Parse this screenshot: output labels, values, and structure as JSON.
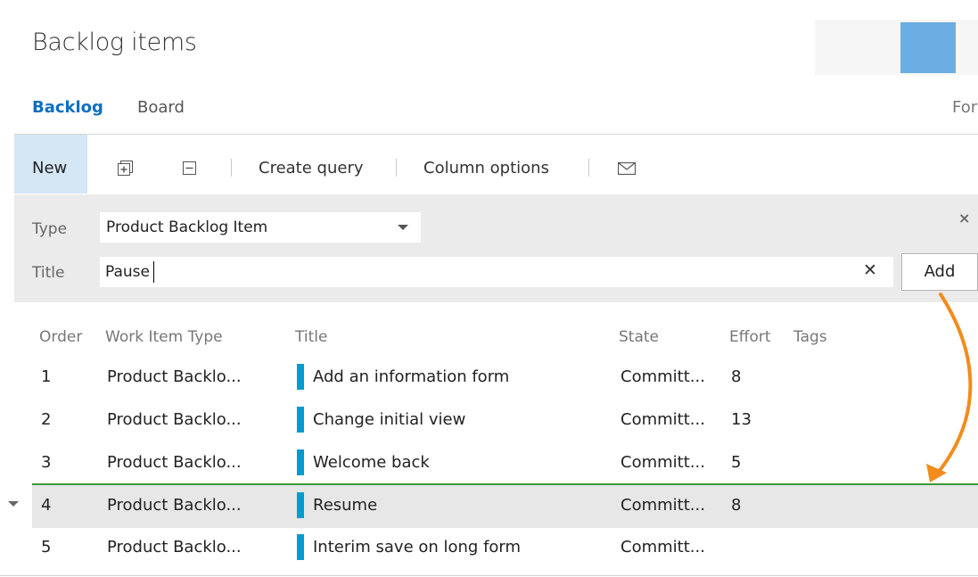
{
  "header": {
    "title": "Backlog items"
  },
  "tabs": [
    {
      "label": "Backlog",
      "active": true
    },
    {
      "label": "Board",
      "active": false
    },
    {
      "label": "For",
      "active": false
    }
  ],
  "toolbar": {
    "new_label": "New",
    "expand_icon": "expand-all-icon",
    "collapse_icon": "collapse-all-icon",
    "create_query_label": "Create query",
    "column_options_label": "Column options",
    "email_icon": "envelope-icon"
  },
  "form": {
    "type_label": "Type",
    "type_value": "Product Backlog Item",
    "title_label": "Title",
    "title_value": "Pause",
    "clear_glyph": "✕",
    "close_glyph": "×",
    "add_label": "Add"
  },
  "table": {
    "columns": [
      "Order",
      "Work Item Type",
      "Title",
      "State",
      "Effort",
      "Tags"
    ],
    "rows": [
      {
        "order": "1",
        "type": "Product Backlo...",
        "title": "Add an information form",
        "state": "Committ...",
        "effort": "8",
        "tags": ""
      },
      {
        "order": "2",
        "type": "Product Backlo...",
        "title": "Change initial view",
        "state": "Committ...",
        "effort": "13",
        "tags": ""
      },
      {
        "order": "3",
        "type": "Product Backlo...",
        "title": "Welcome back",
        "state": "Committ...",
        "effort": "5",
        "tags": ""
      },
      {
        "order": "4",
        "type": "Product Backlo...",
        "title": "Resume",
        "state": "Committ...",
        "effort": "8",
        "tags": ""
      },
      {
        "order": "5",
        "type": "Product Backlo...",
        "title": "Interim save on long form",
        "state": "Committ...",
        "effort": "",
        "tags": ""
      }
    ]
  },
  "colors": {
    "accent": "#0d6fc2",
    "work_item_bar": "#009ccc",
    "drop_indicator": "#3a9a3a",
    "annotation_arrow": "#f28c1c"
  }
}
